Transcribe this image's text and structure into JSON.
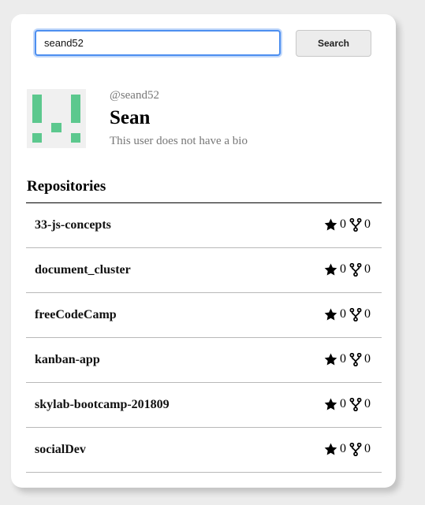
{
  "search": {
    "value": "seand52",
    "button_label": "Search"
  },
  "profile": {
    "username": "@seand52",
    "name": "Sean",
    "bio": "This user does not have a bio",
    "avatar_color": "#5cc88e"
  },
  "repositories": {
    "heading": "Repositories",
    "items": [
      {
        "name": "33-js-concepts",
        "stars": "0",
        "forks": "0"
      },
      {
        "name": "document_cluster",
        "stars": "0",
        "forks": "0"
      },
      {
        "name": "freeCodeCamp",
        "stars": "0",
        "forks": "0"
      },
      {
        "name": "kanban-app",
        "stars": "0",
        "forks": "0"
      },
      {
        "name": "skylab-bootcamp-201809",
        "stars": "0",
        "forks": "0"
      },
      {
        "name": "socialDev",
        "stars": "0",
        "forks": "0"
      }
    ]
  },
  "icons": {
    "star": "star-icon",
    "fork": "fork-icon"
  }
}
